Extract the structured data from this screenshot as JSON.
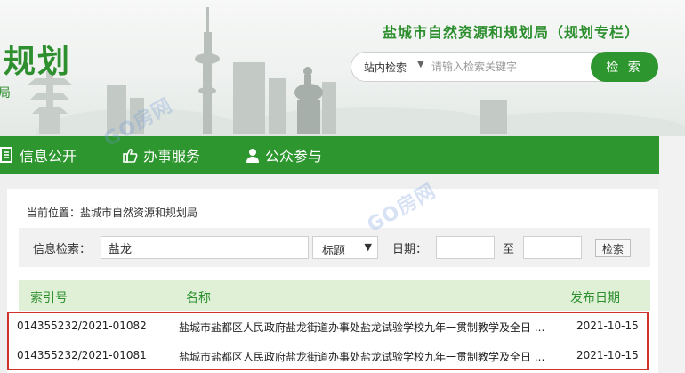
{
  "header": {
    "logo_text": "规划",
    "logo_subtext": "局",
    "site_title": "盐城市自然资源和规划局（规划专栏）",
    "search": {
      "scope": "站内检索",
      "placeholder": "请输入检索关键字",
      "button_label": "检 索"
    }
  },
  "watermark": "GO房网",
  "nav": {
    "items": [
      {
        "label": "信息公开",
        "icon": "document-icon"
      },
      {
        "label": "办事服务",
        "icon": "thumbs-up-icon"
      },
      {
        "label": "公众参与",
        "icon": "user-icon"
      }
    ]
  },
  "breadcrumb": "当前位置：盐城市自然资源和规划局",
  "filter": {
    "search_label": "信息检索：",
    "keyword_value": "盐龙",
    "field_selected": "标题",
    "date_label": "日期：",
    "date_start": "",
    "date_sep": "至",
    "date_end": "",
    "button_label": "检索"
  },
  "table": {
    "columns": [
      "索引号",
      "名称",
      "发布日期"
    ],
    "rows": [
      {
        "index": "014355232/2021-01082",
        "name": "盐城市盐都区人民政府盐龙街道办事处盐龙试验学校九年一贯制教学及全日 ...",
        "date": "2021-10-15"
      },
      {
        "index": "014355232/2021-01081",
        "name": "盐城市盐都区人民政府盐龙街道办事处盐龙试验学校九年一贯制教学及全日 ...",
        "date": "2021-10-15"
      }
    ]
  },
  "colors": {
    "brand_green": "#2e962e",
    "header_row_bg": "#dff0d7",
    "highlight_red": "#d0312d"
  }
}
